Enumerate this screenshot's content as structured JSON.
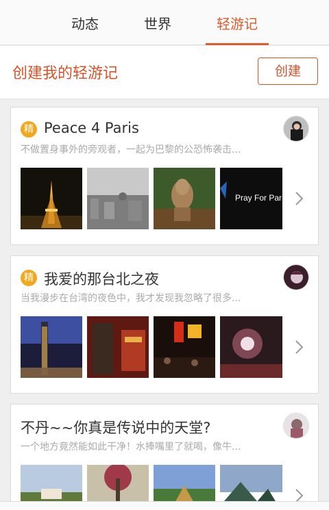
{
  "tabs": [
    {
      "label": "动态"
    },
    {
      "label": "世界"
    },
    {
      "label": "轻游记",
      "active": true
    }
  ],
  "create": {
    "title": "创建我的轻游记",
    "button_label": "创建"
  },
  "cards": [
    {
      "featured": true,
      "badge": "精",
      "title": "Peace 4 Paris",
      "desc": "不做置身事外的旁观者，一起为巴黎的公恐怖袭击...",
      "photo_text": "Pray For Par"
    },
    {
      "featured": true,
      "badge": "精",
      "title": "我爱的那台北之夜",
      "desc": "当我漫步在台湾的夜色中，我才发现我忽略了很多..."
    },
    {
      "featured": false,
      "title": "不丹~~你真是传说中的天堂?",
      "desc": "一个地方竟然能如此干净！水捧嘴里了就喝，像牛..."
    }
  ],
  "colors": {
    "accent": "#e05a2b",
    "badge": "#f0a91e"
  }
}
